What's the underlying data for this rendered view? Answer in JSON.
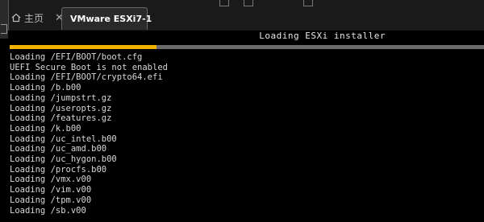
{
  "tabs": {
    "home_label": "主页",
    "vm_label": "VMware ESXi7-1",
    "close_glyph": "✕"
  },
  "console": {
    "title": "Loading ESXi installer",
    "progress_percent": 31,
    "lines": [
      "Loading /EFI/BOOT/boot.cfg",
      "UEFI Secure Boot is not enabled",
      "Loading /EFI/BOOT/crypto64.efi",
      "Loading /b.b00",
      "Loading /jumpstrt.gz",
      "Loading /useropts.gz",
      "Loading /features.gz",
      "Loading /k.b00",
      "Loading /uc_intel.b00",
      "Loading /uc_amd.b00",
      "Loading /uc_hygon.b00",
      "Loading /procfs.b00",
      "Loading /vmx.v00",
      "Loading /vim.v00",
      "Loading /tpm.v00",
      "Loading /sb.v00"
    ]
  },
  "colors": {
    "progress": "#f0b400",
    "track": "#6b6b6b",
    "text": "#d8d8d8"
  }
}
